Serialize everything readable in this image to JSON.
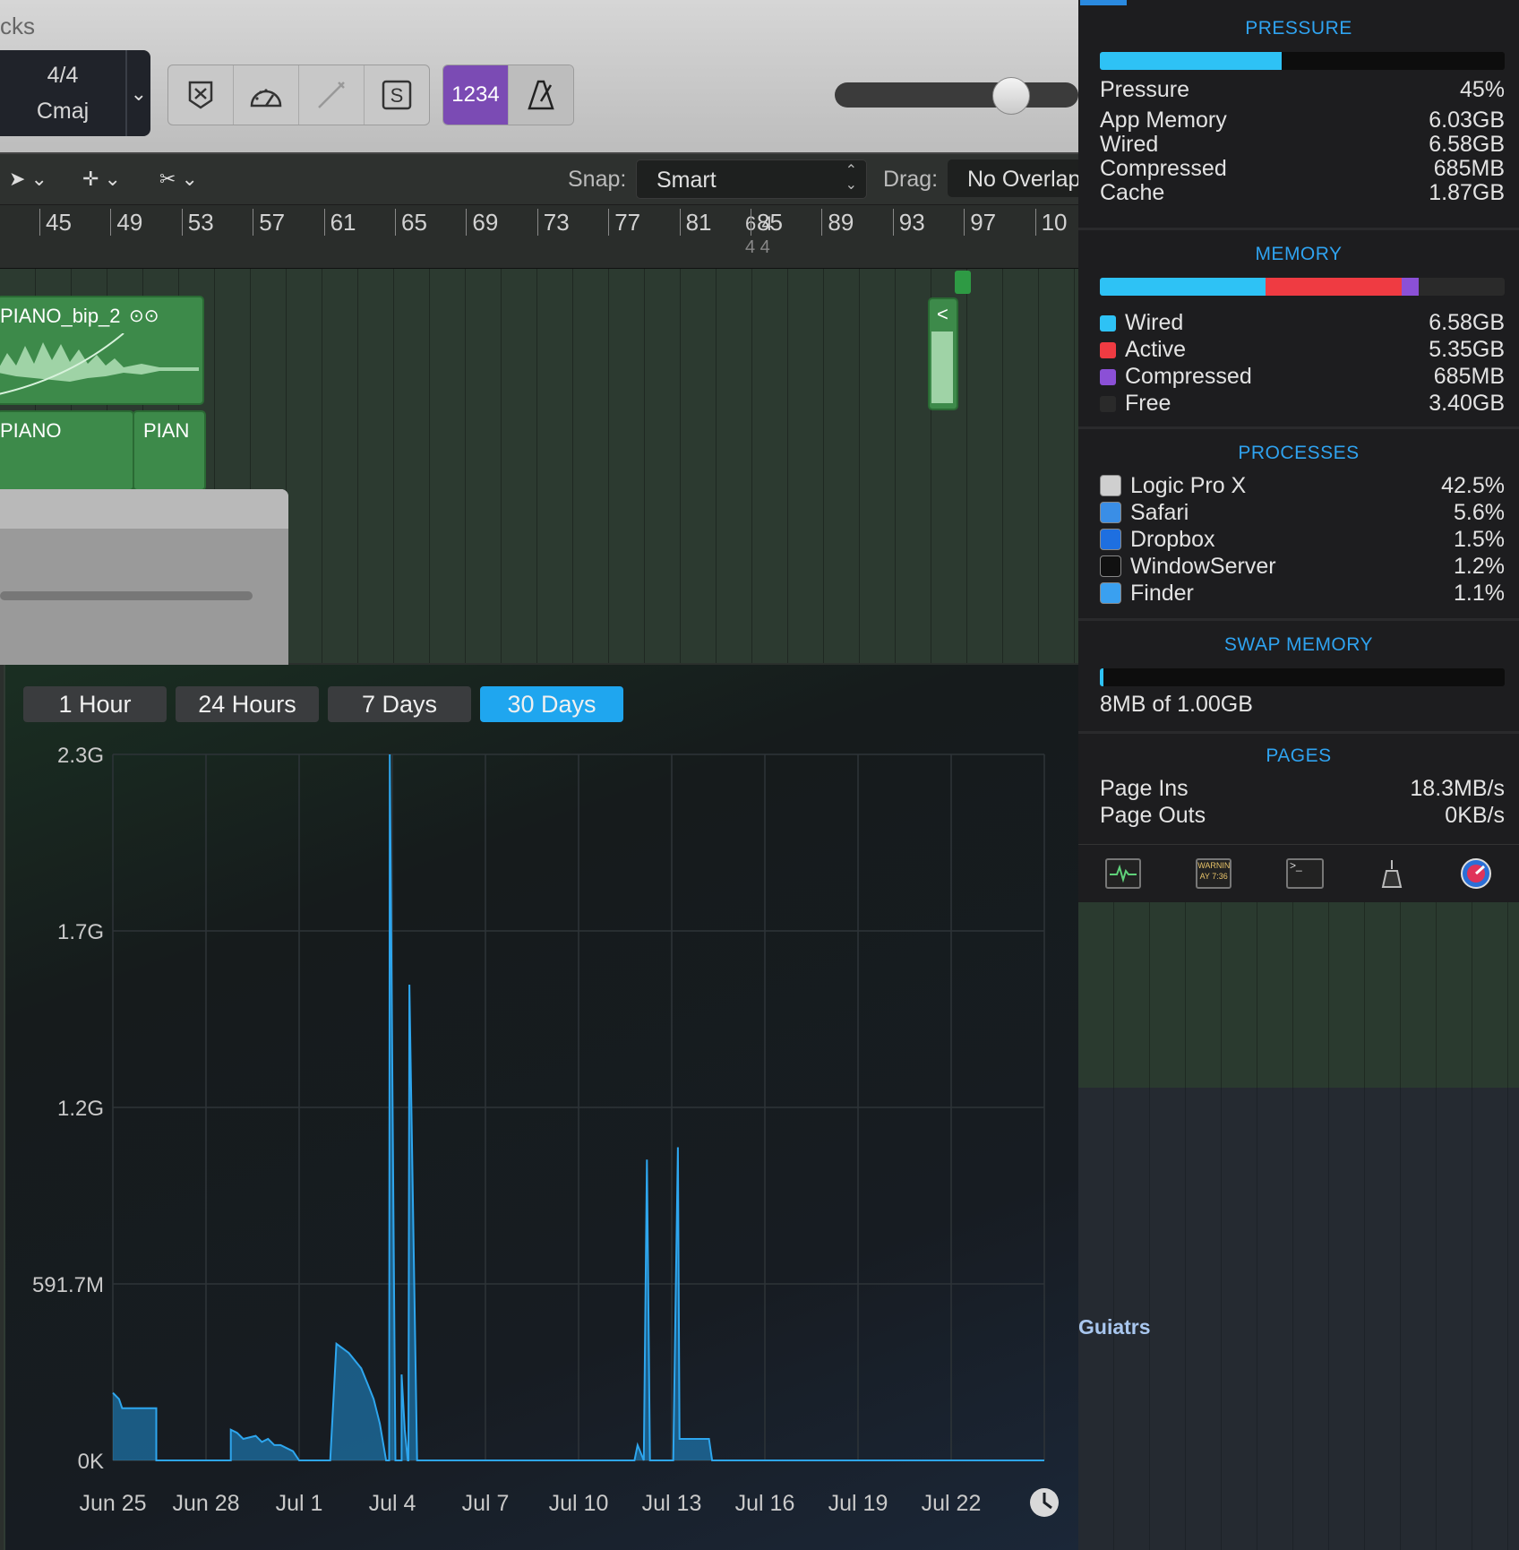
{
  "logic": {
    "title_fragment": "cks",
    "time_signature": "4/4",
    "key": "Cmaj",
    "lcd_count": "1234",
    "snap_label": "Snap:",
    "snap_value": "Smart",
    "drag_label": "Drag:",
    "drag_value": "No Overlap",
    "ruler": [
      "45",
      "49",
      "53",
      "57",
      "61",
      "65",
      "69",
      "73",
      "77",
      "81",
      "85",
      "89",
      "93",
      "97",
      "10"
    ],
    "ruler_signature": "6 4",
    "ruler_signature_sub": "4  4",
    "regions": [
      {
        "label": "PIANO_bip_2"
      },
      {
        "label": "PIANO"
      },
      {
        "label": "PIAN"
      },
      {
        "label": "<"
      }
    ],
    "track_name": "Guiatrs"
  },
  "history": {
    "tabs": [
      "1 Hour",
      "24 Hours",
      "7 Days",
      "30 Days"
    ],
    "active_tab": "30 Days"
  },
  "chart_data": {
    "type": "area",
    "y_ticks": [
      "2.3G",
      "1.7G",
      "1.2G",
      "591.7M",
      "0K"
    ],
    "x_ticks": [
      "Jun 25",
      "Jun 28",
      "Jul 1",
      "Jul 4",
      "Jul 7",
      "Jul 10",
      "Jul 13",
      "Jul 16",
      "Jul 19",
      "Jul 22"
    ],
    "ylim": [
      0,
      2.3
    ],
    "y_unit": "G",
    "grid": true,
    "color": "#1f8fd6",
    "x": [
      0,
      0.2,
      0.3,
      0.6,
      1.4,
      1.4,
      1.8,
      2.0,
      2.1,
      2.2,
      2.3,
      2.3,
      3.8,
      3.8,
      4.0,
      4.2,
      4.6,
      4.8,
      5.0,
      5.2,
      5.4,
      5.6,
      5.8,
      6.0,
      6.0,
      6.6,
      6.8,
      7.0,
      7.2,
      7.6,
      8.0,
      8.2,
      8.4,
      8.6,
      8.8,
      8.9,
      8.92,
      9.1,
      9.3,
      9.3,
      9.4,
      9.5,
      9.52,
      9.55,
      9.8,
      9.82,
      10.0,
      10.2,
      10.4,
      10.6,
      11.0,
      11.4,
      11.6,
      12.0,
      12.8,
      13.0,
      13.3,
      13.4,
      13.5,
      13.6,
      14.2,
      14.6,
      16.8,
      16.9,
      17.1,
      17.2,
      17.3,
      18.0,
      18.05,
      18.2,
      18.25,
      18.4,
      18.6,
      19.0,
      19.2,
      19.3,
      19.4,
      19.5,
      20.0,
      20.2,
      20.8,
      22.8,
      23.0,
      23.2,
      23.3,
      23.4,
      24.0,
      24.2,
      24.4,
      25.0,
      25.4,
      25.6,
      25.8,
      26.0,
      26.1,
      26.2,
      26.4,
      26.6,
      27.0,
      27.5,
      28.0,
      28.2,
      28.6,
      29.0,
      29.2,
      29.3,
      29.4,
      29.6,
      30.0
    ],
    "y": [
      0.22,
      0.2,
      0.17,
      0.17,
      0.17,
      0.0,
      0.0,
      0.0,
      0.0,
      0.0,
      0.0,
      0.0,
      0.0,
      0.1,
      0.09,
      0.07,
      0.08,
      0.06,
      0.07,
      0.05,
      0.05,
      0.04,
      0.03,
      0.0,
      0.0,
      0.0,
      0.0,
      0.0,
      0.38,
      0.35,
      0.3,
      0.25,
      0.2,
      0.12,
      0.0,
      0.0,
      2.3,
      0.0,
      0.0,
      0.28,
      0.1,
      0.0,
      0.0,
      1.55,
      0.0,
      0.0,
      0.0,
      0.0,
      0.0,
      0.0,
      0.0,
      0.0,
      0.0,
      0.0,
      0.0,
      0.0,
      0.0,
      0.0,
      0.0,
      0.0,
      0.0,
      0.0,
      0.0,
      0.05,
      0.0,
      0.98,
      0.0,
      0.0,
      0.0,
      1.02,
      0.07,
      0.07,
      0.07,
      0.07,
      0.07,
      0.0,
      0.0,
      0.0,
      0.0,
      0.0,
      0.0,
      0.0,
      0.0,
      0.0,
      0.0,
      0.0,
      0.0,
      0.0,
      0.0,
      0.0,
      0.0,
      0.0,
      0.0,
      0.0,
      0.0,
      0.0,
      0.0,
      0.0,
      0.0,
      0.0,
      0.0,
      0.0,
      0.0,
      0.0,
      0.0,
      0.0,
      0.0,
      0.0,
      0.0
    ]
  },
  "istat": {
    "pressure": {
      "title": "PRESSURE",
      "fraction": 0.45,
      "rows": [
        {
          "label": "Pressure",
          "value": "45%"
        },
        {
          "label": "App Memory",
          "value": "6.03GB"
        },
        {
          "label": "Wired",
          "value": "6.58GB"
        },
        {
          "label": "Compressed",
          "value": "685MB"
        },
        {
          "label": "Cache",
          "value": "1.87GB"
        }
      ]
    },
    "memory": {
      "title": "MEMORY",
      "segments": [
        {
          "label": "Wired",
          "value": "6.58GB",
          "color": "#2ec2f5",
          "fraction": 0.41
        },
        {
          "label": "Active",
          "value": "5.35GB",
          "color": "#ef3b42",
          "fraction": 0.335
        },
        {
          "label": "Compressed",
          "value": "685MB",
          "color": "#8b50d6",
          "fraction": 0.043
        },
        {
          "label": "Free",
          "value": "3.40GB",
          "color": "#2a2a2a",
          "fraction": 0.212
        }
      ]
    },
    "processes": {
      "title": "PROCESSES",
      "rows": [
        {
          "label": "Logic Pro X",
          "value": "42.5%",
          "icon": "logic-icon"
        },
        {
          "label": "Safari",
          "value": "5.6%",
          "icon": "safari-icon"
        },
        {
          "label": "Dropbox",
          "value": "1.5%",
          "icon": "dropbox-icon"
        },
        {
          "label": "WindowServer",
          "value": "1.2%",
          "icon": "windowserver-icon"
        },
        {
          "label": "Finder",
          "value": "1.1%",
          "icon": "finder-icon"
        }
      ]
    },
    "swap": {
      "title": "SWAP MEMORY",
      "text": "8MB of 1.00GB",
      "fraction": 0.008
    },
    "pages": {
      "title": "PAGES",
      "rows": [
        {
          "label": "Page Ins",
          "value": "18.3MB/s"
        },
        {
          "label": "Page Outs",
          "value": "0KB/s"
        }
      ]
    },
    "footer_icons": [
      "activity-monitor-icon",
      "console-icon",
      "terminal-icon",
      "disk-cleaner-icon",
      "istat-icon"
    ],
    "console_icon_text": "WARNIN AY 7:36"
  }
}
